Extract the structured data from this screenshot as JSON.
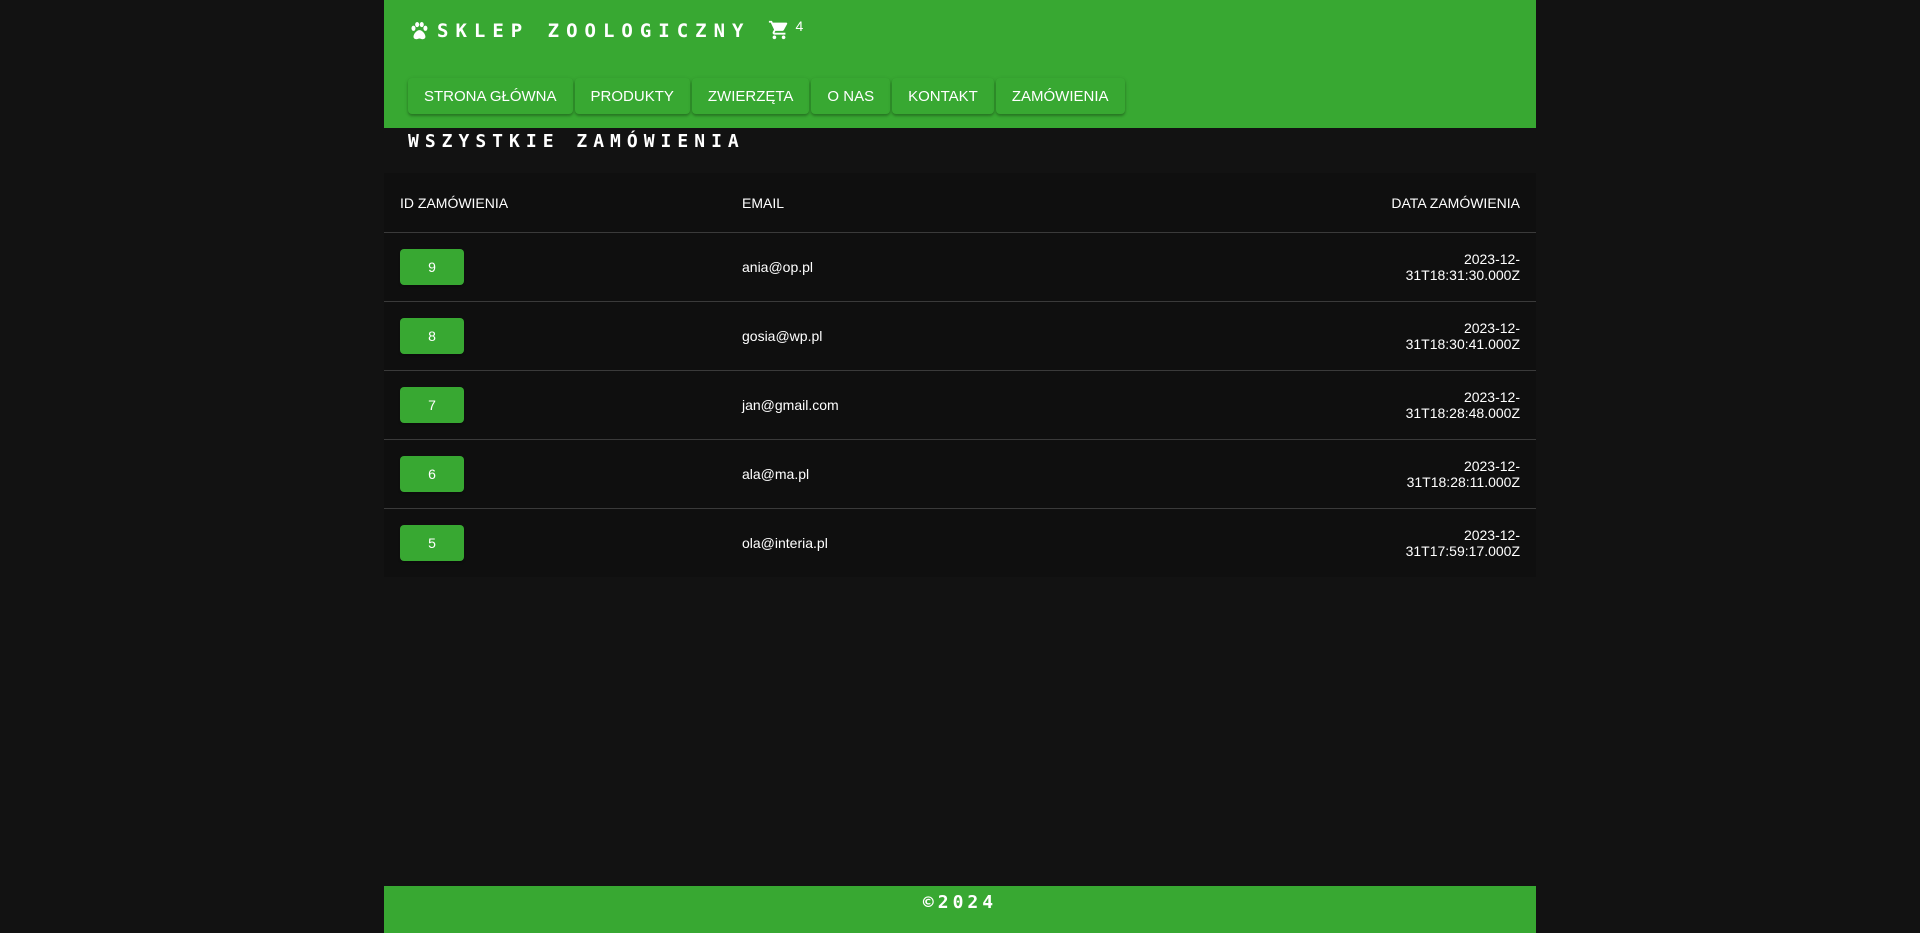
{
  "header": {
    "title": "SKLEP ZOOLOGICZNY",
    "logo_icon": "paw-icon",
    "cart_icon": "shopping-cart-icon",
    "cart_count": "4",
    "accent_color": "#38a832"
  },
  "nav": {
    "items": [
      {
        "label": "STRONA GŁÓWNA"
      },
      {
        "label": "PRODUKTY"
      },
      {
        "label": "ZWIERZĘTA"
      },
      {
        "label": "O NAS"
      },
      {
        "label": "KONTAKT"
      },
      {
        "label": "ZAMÓWIENIA"
      }
    ]
  },
  "main": {
    "title": "WSZYSTKIE ZAMÓWIENIA",
    "table": {
      "columns": [
        "ID ZAMÓWIENIA",
        "EMAIL",
        "DATA ZAMÓWIENIA"
      ],
      "rows": [
        {
          "id": "9",
          "email": "ania@op.pl",
          "date": "2023-12-31T18:31:30.000Z"
        },
        {
          "id": "8",
          "email": "gosia@wp.pl",
          "date": "2023-12-31T18:30:41.000Z"
        },
        {
          "id": "7",
          "email": "jan@gmail.com",
          "date": "2023-12-31T18:28:48.000Z"
        },
        {
          "id": "6",
          "email": "ala@ma.pl",
          "date": "2023-12-31T18:28:11.000Z"
        },
        {
          "id": "5",
          "email": "ola@interia.pl",
          "date": "2023-12-31T17:59:17.000Z"
        }
      ]
    }
  },
  "footer": {
    "copyright": "©2024"
  },
  "colors": {
    "background": "#121212",
    "accent": "#38a832",
    "text": "#ffffff"
  }
}
